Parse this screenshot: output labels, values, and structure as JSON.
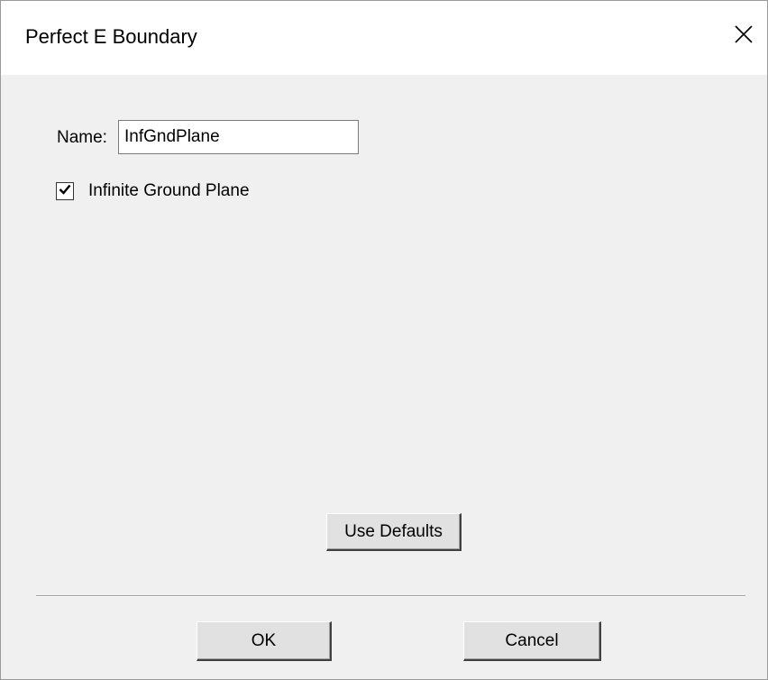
{
  "window": {
    "title": "Perfect E Boundary",
    "close_icon": "close-icon"
  },
  "form": {
    "name_label": "Name:",
    "name_value": "InfGndPlane",
    "infinite_ground_label": "Infinite Ground Plane",
    "infinite_ground_checked": true
  },
  "buttons": {
    "use_defaults": "Use Defaults",
    "ok": "OK",
    "cancel": "Cancel"
  }
}
